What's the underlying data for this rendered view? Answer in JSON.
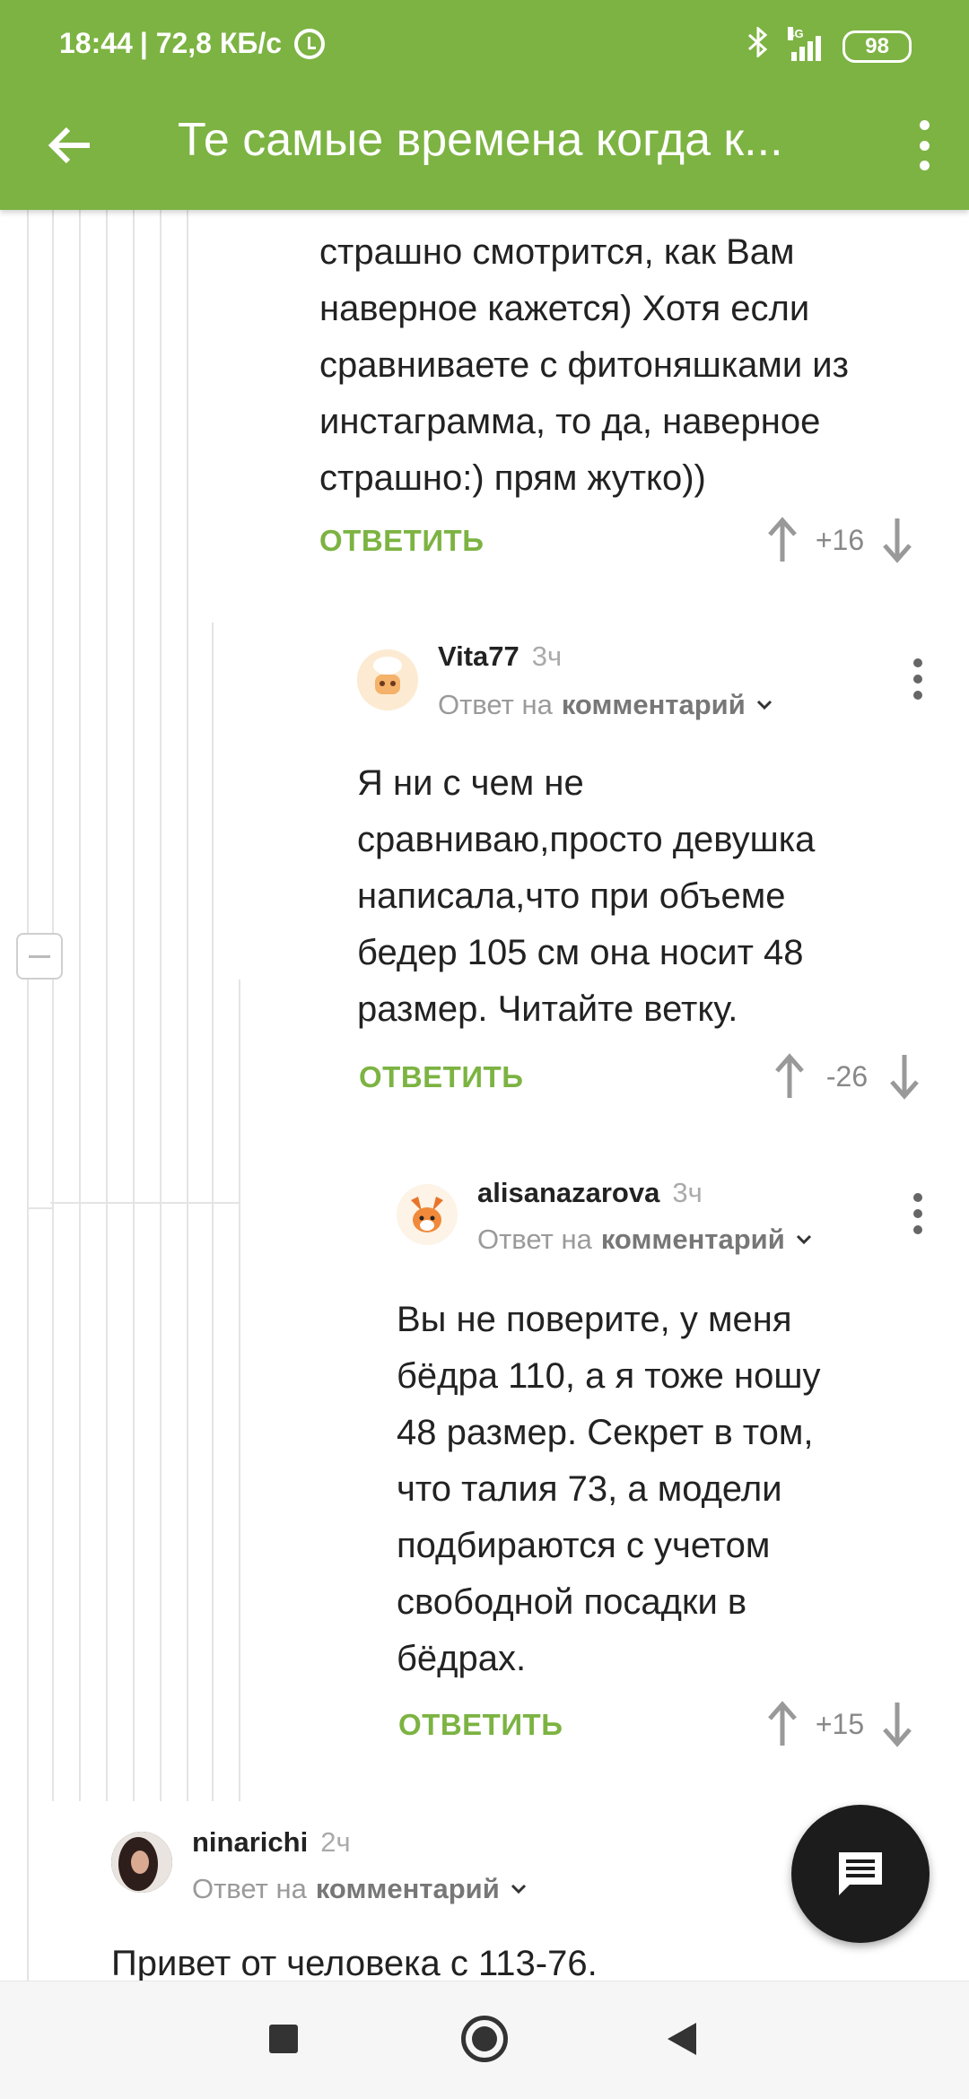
{
  "status_bar": {
    "time": "18:44",
    "speed": "| 72,8 КБ/с",
    "network": "4G",
    "battery": "98"
  },
  "toolbar": {
    "title": "Те самые времена когда к...",
    "back_icon": "arrow-back-icon",
    "menu_icon": "more-vertical-icon"
  },
  "comments": [
    {
      "lines": [
        "страшно смотрится, как Вам",
        "наверное кажется) Хотя если",
        "сравниваете с фитоняшками из",
        "инстаграмма, то да, наверное",
        "страшно:) прям жутко))"
      ],
      "reply_label": "ОТВЕТИТЬ",
      "score": "+16"
    },
    {
      "author": "Vita77",
      "time": "3ч",
      "reply_prefix": "Ответ на",
      "reply_target": "комментарий",
      "lines": [
        "Я ни с чем не",
        "сравниваю,просто девушка",
        "написала,что при объеме",
        "бедер 105 см она носит 48",
        "размер. Читайте ветку."
      ],
      "reply_label": "ОТВЕТИТЬ",
      "score": "-26"
    },
    {
      "author": "alisanazarova",
      "time": "3ч",
      "reply_prefix": "Ответ на",
      "reply_target": "комментарий",
      "lines": [
        "Вы не поверите, у меня",
        "бёдра 110, а я тоже ношу",
        "48 размер. Секрет в том,",
        "что талия 73, а модели",
        "подбираются с учетом",
        "свободной посадки в",
        "бёдрах."
      ],
      "reply_label": "ОТВЕТИТЬ",
      "score": "+15"
    },
    {
      "author": "ninarichi",
      "time": "2ч",
      "reply_prefix": "Ответ на",
      "reply_target": "комментарий",
      "lines": [
        "Привет от человека с 113-76."
      ]
    }
  ],
  "colors": {
    "accent": "#7cb342",
    "fab": "#1c1c1c"
  }
}
